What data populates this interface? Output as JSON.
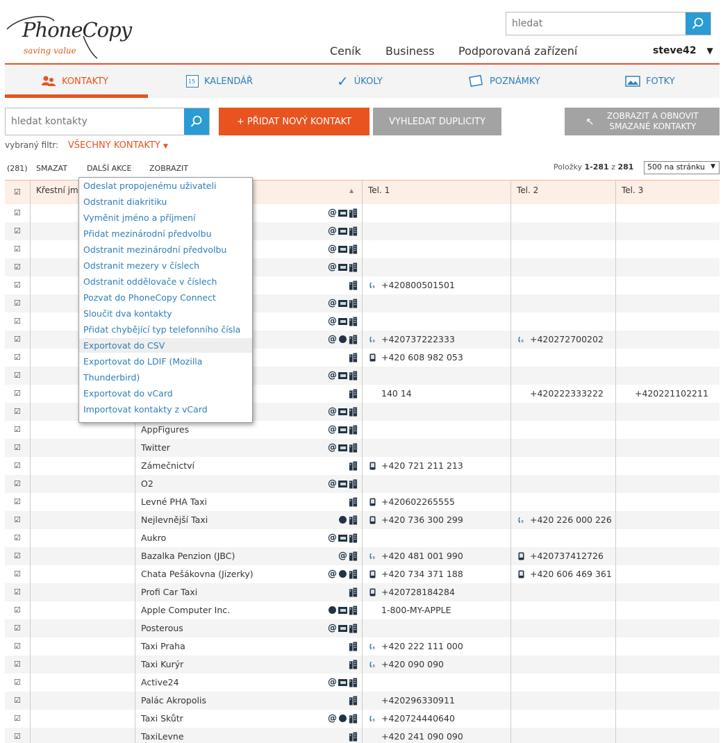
{
  "brand": {
    "name": "PhoneCopy",
    "tagline": "saving value"
  },
  "search": {
    "placeholder": "hledat"
  },
  "nav": {
    "items": [
      "Ceník",
      "Business",
      "Podporovaná zařízení"
    ]
  },
  "user": {
    "name": "steve42"
  },
  "tabs": [
    {
      "label": "KONTAKTY",
      "icon": "contacts-icon",
      "active": true
    },
    {
      "label": "KALENDÁŘ",
      "icon": "calendar-icon",
      "calendar_day": "15"
    },
    {
      "label": "ÚKOLY",
      "icon": "check-icon"
    },
    {
      "label": "POZNÁMKY",
      "icon": "note-icon"
    },
    {
      "label": "FOTKY",
      "icon": "photo-icon"
    }
  ],
  "toolbar": {
    "contact_search_placeholder": "hledat kontakty",
    "add_label": "+  PŘIDAT NOVÝ KONTAKT",
    "duplicates_label": "VYHLEDAT DUPLICITY",
    "restore_line1": "ZOBRAZIT A OBNOVIT",
    "restore_line2": "SMAZANÉ KONTAKTY"
  },
  "filter": {
    "label": "vybraný filtr:",
    "value": "VŠECHNY KONTAKTY"
  },
  "actions": {
    "count": "(281)",
    "delete": "SMAZAT",
    "more": "DALŠÍ AKCE",
    "view": "ZOBRAZIT"
  },
  "pager": {
    "prefix": "Položky",
    "range": "1-281",
    "of": "z",
    "total": "281",
    "per_page": "500 na stránku"
  },
  "table": {
    "headers": {
      "first_name": "Křestní jm",
      "tel1": "Tel. 1",
      "tel2": "Tel. 2",
      "tel3": "Tel. 3"
    },
    "rows": [
      {
        "name": "",
        "icons": [
          "at",
          "card",
          "bld"
        ],
        "t1": "",
        "t1i": "",
        "t2": "",
        "t2i": "",
        "t3": ""
      },
      {
        "name": "",
        "icons": [
          "at",
          "card",
          "bld"
        ],
        "t1": "",
        "t1i": "",
        "t2": "",
        "t2i": "",
        "t3": ""
      },
      {
        "name": "",
        "icons": [
          "at",
          "card",
          "bld"
        ],
        "t1": "",
        "t1i": "",
        "t2": "",
        "t2i": "",
        "t3": ""
      },
      {
        "name": "",
        "icons": [
          "at",
          "card",
          "bld"
        ],
        "t1": "",
        "t1i": "",
        "t2": "",
        "t2i": "",
        "t3": ""
      },
      {
        "name": "",
        "icons": [
          "bld"
        ],
        "t1": "+420800501501",
        "t1i": "work",
        "t2": "",
        "t2i": "",
        "t3": ""
      },
      {
        "name": "",
        "icons": [
          "at",
          "card",
          "bld"
        ],
        "t1": "",
        "t1i": "",
        "t2": "",
        "t2i": "",
        "t3": ""
      },
      {
        "name": "",
        "icons": [
          "at",
          "card",
          "bld"
        ],
        "t1": "",
        "t1i": "",
        "t2": "",
        "t2i": "",
        "t3": ""
      },
      {
        "name": "",
        "icons": [
          "at",
          "globe",
          "bld"
        ],
        "t1": "+420737222333",
        "t1i": "work",
        "t2": "+420272700202",
        "t2i": "work",
        "t3": ""
      },
      {
        "name": "",
        "icons": [
          "bld"
        ],
        "t1": "+420 608 982 053",
        "t1i": "mobile",
        "t2": "",
        "t2i": "",
        "t3": ""
      },
      {
        "name": "",
        "icons": [
          "at",
          "card",
          "bld"
        ],
        "t1": "",
        "t1i": "",
        "t2": "",
        "t2i": "",
        "t3": ""
      },
      {
        "name": "",
        "icons": [
          "bld"
        ],
        "t1": "140 14",
        "t1i": "",
        "t2": "+420222333222",
        "t2i": "",
        "t3": "+420221102211"
      },
      {
        "name": "",
        "icons": [
          "at",
          "card",
          "bld"
        ],
        "t1": "",
        "t1i": "",
        "t2": "",
        "t2i": "",
        "t3": ""
      },
      {
        "name": "AppFigures",
        "icons": [
          "at",
          "card",
          "bld"
        ],
        "t1": "",
        "t1i": "",
        "t2": "",
        "t2i": "",
        "t3": ""
      },
      {
        "name": "Twitter",
        "icons": [
          "at",
          "card",
          "bld"
        ],
        "t1": "",
        "t1i": "",
        "t2": "",
        "t2i": "",
        "t3": ""
      },
      {
        "name": "Zámečnictví",
        "icons": [
          "bld"
        ],
        "t1": "+420 721 211 213",
        "t1i": "mobile",
        "t2": "",
        "t2i": "",
        "t3": ""
      },
      {
        "name": "O2",
        "icons": [
          "at",
          "card",
          "bld"
        ],
        "t1": "",
        "t1i": "",
        "t2": "",
        "t2i": "",
        "t3": ""
      },
      {
        "name": "Levné PHA Taxi",
        "icons": [
          "bld"
        ],
        "t1": "+420602265555",
        "t1i": "mobile",
        "t2": "",
        "t2i": "",
        "t3": ""
      },
      {
        "name": "Nejlevnější Taxi",
        "icons": [
          "globe",
          "bld"
        ],
        "t1": "+420 736 300 299",
        "t1i": "mobile",
        "t2": "+420 226 000 226",
        "t2i": "work",
        "t3": ""
      },
      {
        "name": "Aukro",
        "icons": [
          "at",
          "card",
          "bld"
        ],
        "t1": "",
        "t1i": "",
        "t2": "",
        "t2i": "",
        "t3": ""
      },
      {
        "name": "Bazalka Penzion (JBC)",
        "icons": [
          "at",
          "bld"
        ],
        "t1": "+420 481 001 990",
        "t1i": "work",
        "t2": "+420737412726",
        "t2i": "mobile",
        "t3": ""
      },
      {
        "name": "Chata Pešákovna (Jizerky)",
        "icons": [
          "at",
          "globe",
          "bld"
        ],
        "t1": "+420 734 371 188",
        "t1i": "mobile",
        "t2": "+420 606 469 361",
        "t2i": "mobile",
        "t3": ""
      },
      {
        "name": "Profi Car Taxi",
        "icons": [
          "bld"
        ],
        "t1": "+420728184284",
        "t1i": "mobile",
        "t2": "",
        "t2i": "",
        "t3": ""
      },
      {
        "name": "Apple Computer Inc.",
        "icons": [
          "globe",
          "card",
          "bld"
        ],
        "t1": "1-800-MY-APPLE",
        "t1i": "",
        "t2": "",
        "t2i": "",
        "t3": ""
      },
      {
        "name": "Posterous",
        "icons": [
          "at",
          "card",
          "bld"
        ],
        "t1": "",
        "t1i": "",
        "t2": "",
        "t2i": "",
        "t3": ""
      },
      {
        "name": "Taxi Praha",
        "icons": [
          "bld"
        ],
        "t1": "+420 222 111 000",
        "t1i": "work",
        "t2": "",
        "t2i": "",
        "t3": ""
      },
      {
        "name": "Taxi Kurýr",
        "icons": [
          "bld"
        ],
        "t1": "+420 090 090",
        "t1i": "work",
        "t2": "",
        "t2i": "",
        "t3": ""
      },
      {
        "name": "Active24",
        "icons": [
          "at",
          "card",
          "bld"
        ],
        "t1": "",
        "t1i": "",
        "t2": "",
        "t2i": "",
        "t3": ""
      },
      {
        "name": "Palác Akropolis",
        "icons": [
          "bld"
        ],
        "t1": "+420296330911",
        "t1i": "",
        "t2": "",
        "t2i": "",
        "t3": ""
      },
      {
        "name": "Taxi Skůtr",
        "icons": [
          "at",
          "globe",
          "bld"
        ],
        "t1": "+420724440640",
        "t1i": "work",
        "t2": "",
        "t2i": "",
        "t3": ""
      },
      {
        "name": "TaxiLevne",
        "icons": [
          "bld"
        ],
        "t1": "+420 241 090 090",
        "t1i": "",
        "t2": "",
        "t2i": "",
        "t3": ""
      }
    ]
  },
  "dropdown": {
    "items": [
      "Odeslat propojenému uživateli",
      "Odstranit diakritiku",
      "Vyměnit jméno a příjmení",
      "Přidat mezinárodní předvolbu",
      "Odstranit mezinárodní předvolbu",
      "Odstranit mezery v číslech",
      "Odstranit oddělovače v číslech",
      "Pozvat do PhoneCopy Connect",
      "Sloučit dva kontakty",
      "Přidat chybějící typ telefonního čísla",
      "Exportovat do CSV",
      "Exportovat do LDIF (Mozilla",
      "Thunderbird)",
      "Exportovat do vCard",
      "Importovat kontakty z vCard"
    ],
    "highlighted": "Exportovat do CSV"
  },
  "colors": {
    "accent": "#e8531f",
    "link": "#2e7fb8",
    "search_button": "#2b9bd3",
    "gray_button": "#a3a3a3"
  }
}
